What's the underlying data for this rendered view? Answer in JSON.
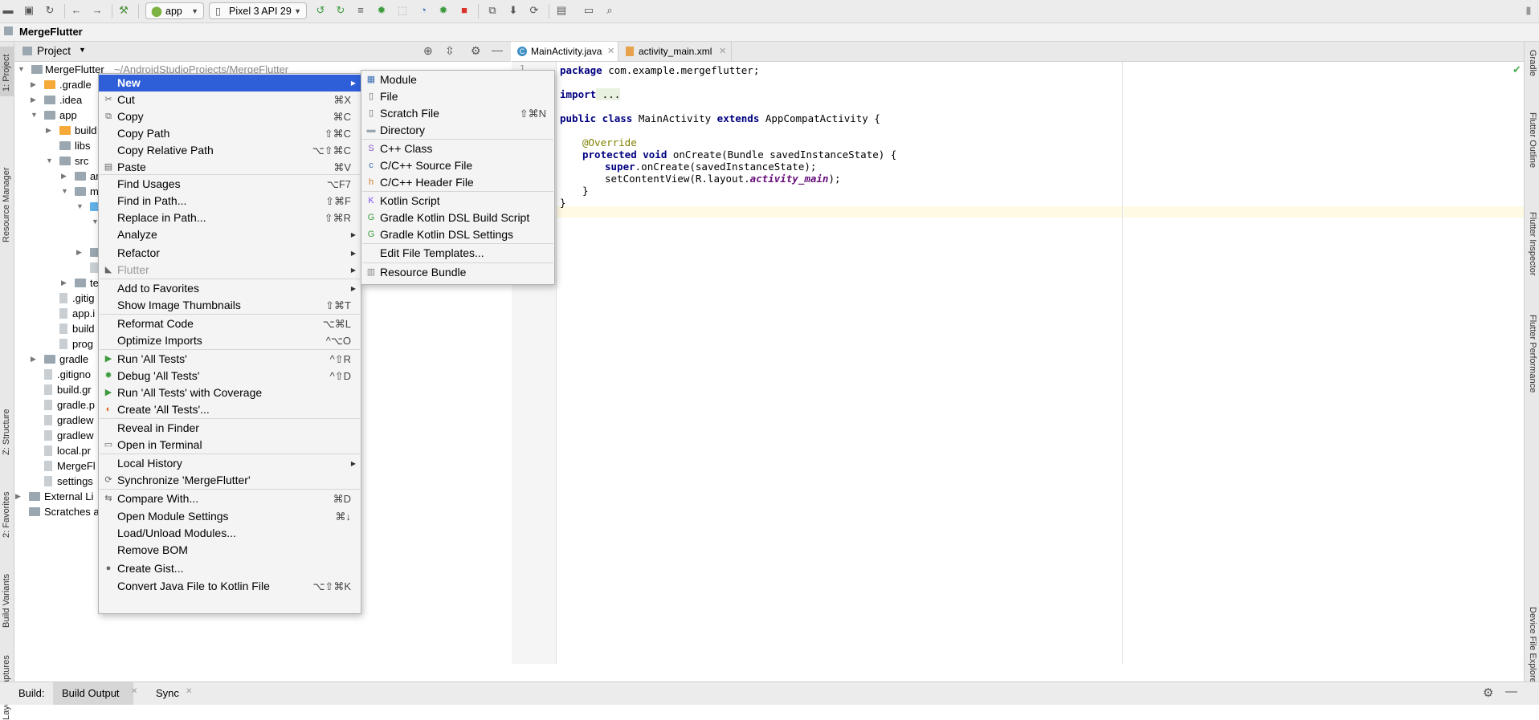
{
  "toolbar": {
    "run_config": "app",
    "device": "Pixel 3 API 29"
  },
  "breadcrumb": {
    "project": "MergeFlutter"
  },
  "left_stripe": [
    "1: Project",
    "Resource Manager",
    "Z: Structure",
    "2: Favorites",
    "Build Variants",
    "Layout Captures"
  ],
  "right_stripe": [
    "Gradle",
    "Flutter Outline",
    "Flutter Inspector",
    "Flutter Performance",
    "Device File Explorer"
  ],
  "project_panel": {
    "title": "Project",
    "root_name": "MergeFlutter",
    "root_path": "~/AndroidStudioProjects/MergeFlutter",
    "rows": [
      {
        "label": ".gradle"
      },
      {
        "label": ".idea"
      },
      {
        "label": "app"
      },
      {
        "label": "build"
      },
      {
        "label": "libs"
      },
      {
        "label": "src"
      },
      {
        "label": "ar"
      },
      {
        "label": "m"
      },
      {
        "label": ""
      },
      {
        "label": ""
      },
      {
        "label": ""
      },
      {
        "label": ""
      },
      {
        "label": ""
      },
      {
        "label": "te"
      },
      {
        "label": ".gitig"
      },
      {
        "label": "app.i"
      },
      {
        "label": "build"
      },
      {
        "label": "prog"
      },
      {
        "label": "gradle"
      },
      {
        "label": ".gitigno"
      },
      {
        "label": "build.gr"
      },
      {
        "label": "gradle.p"
      },
      {
        "label": "gradlew"
      },
      {
        "label": "gradlew"
      },
      {
        "label": "local.pr"
      },
      {
        "label": "MergeFl"
      },
      {
        "label": "settings"
      },
      {
        "label": "External Li"
      },
      {
        "label": "Scratches a"
      }
    ]
  },
  "editor": {
    "tabs": [
      "MainActivity.java",
      "activity_main.xml"
    ],
    "line_number": "1",
    "code": {
      "l1_kw": "package",
      "l1_rest": " com.example.mergeflutter;",
      "l2_kw": "import",
      "l2_rest": " ...",
      "l3_kw1": "public class",
      "l3_mid": " MainActivity ",
      "l3_kw2": "extends",
      "l3_rest": " AppCompatActivity {",
      "l4_ann": "@Override",
      "l5_kw": "protected void",
      "l5_rest": " onCreate(Bundle savedInstanceState) {",
      "l6_kw": "super",
      "l6_rest": ".onCreate(savedInstanceState);",
      "l7_pre": "setContentView(R.layout.",
      "l7_it": "activity_main",
      "l7_post": ");",
      "l8": "}",
      "l9": "}"
    }
  },
  "context_menu": {
    "items": [
      {
        "label": "New",
        "shortcut": "",
        "submenu": true,
        "icon": ""
      },
      {
        "label": "Cut",
        "shortcut": "⌘X",
        "icon": "scissors-icon"
      },
      {
        "label": "Copy",
        "shortcut": "⌘C",
        "icon": "copy-icon"
      },
      {
        "label": "Copy Path",
        "shortcut": "⇧⌘C"
      },
      {
        "label": "Copy Relative Path",
        "shortcut": "⌥⇧⌘C"
      },
      {
        "label": "Paste",
        "shortcut": "⌘V",
        "icon": "paste-icon"
      },
      {
        "label": "Find Usages",
        "shortcut": "⌥F7"
      },
      {
        "label": "Find in Path...",
        "shortcut": "⇧⌘F"
      },
      {
        "label": "Replace in Path...",
        "shortcut": "⇧⌘R"
      },
      {
        "label": "Analyze",
        "submenu": true
      },
      {
        "label": "Refactor",
        "submenu": true
      },
      {
        "label": "Flutter",
        "submenu": true,
        "disabled": true,
        "icon": "flutter-icon"
      },
      {
        "label": "Add to Favorites",
        "submenu": true
      },
      {
        "label": "Show Image Thumbnails",
        "shortcut": "⇧⌘T"
      },
      {
        "label": "Reformat Code",
        "shortcut": "⌥⌘L"
      },
      {
        "label": "Optimize Imports",
        "shortcut": "^⌥O"
      },
      {
        "label": "Run 'All Tests'",
        "shortcut": "^⇧R",
        "icon": "run-icon"
      },
      {
        "label": "Debug 'All Tests'",
        "shortcut": "^⇧D",
        "icon": "debug-icon"
      },
      {
        "label": "Run 'All Tests' with Coverage",
        "icon": "coverage-icon"
      },
      {
        "label": "Create 'All Tests'...",
        "icon": "create-test-icon"
      },
      {
        "label": "Reveal in Finder"
      },
      {
        "label": "Open in Terminal",
        "icon": "terminal-icon"
      },
      {
        "label": "Local History",
        "submenu": true
      },
      {
        "label": "Synchronize 'MergeFlutter'",
        "icon": "sync-icon"
      },
      {
        "label": "Compare With...",
        "shortcut": "⌘D",
        "icon": "compare-icon"
      },
      {
        "label": "Open Module Settings",
        "shortcut": "⌘↓"
      },
      {
        "label": "Load/Unload Modules..."
      },
      {
        "label": "Remove BOM"
      },
      {
        "label": "Create Gist...",
        "icon": "github-icon"
      },
      {
        "label": "Convert Java File to Kotlin File",
        "shortcut": "⌥⇧⌘K"
      }
    ]
  },
  "new_submenu": {
    "items": [
      {
        "label": "Module",
        "shortcut": ""
      },
      {
        "label": "File",
        "shortcut": ""
      },
      {
        "label": "Scratch File",
        "shortcut": "⇧⌘N"
      },
      {
        "label": "Directory",
        "shortcut": ""
      },
      {
        "label": "C++ Class",
        "shortcut": ""
      },
      {
        "label": "C/C++ Source File",
        "shortcut": ""
      },
      {
        "label": "C/C++ Header File",
        "shortcut": ""
      },
      {
        "label": "Kotlin Script",
        "shortcut": ""
      },
      {
        "label": "Gradle Kotlin DSL Build Script",
        "shortcut": ""
      },
      {
        "label": "Gradle Kotlin DSL Settings",
        "shortcut": ""
      },
      {
        "label": "Edit File Templates...",
        "shortcut": ""
      },
      {
        "label": "Resource Bundle",
        "shortcut": ""
      }
    ]
  },
  "bottom_bar": {
    "build_label": "Build:",
    "tabs": [
      "Build Output",
      "Sync"
    ]
  }
}
